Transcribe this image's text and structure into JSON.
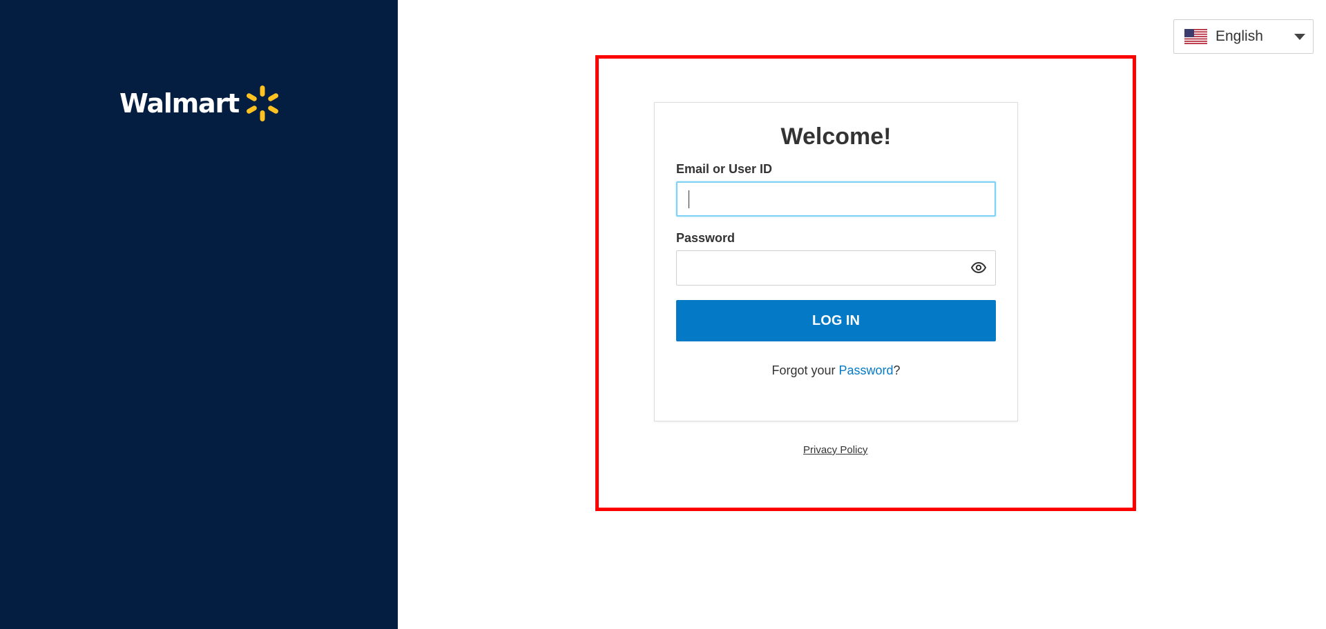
{
  "brand": {
    "logo_text": "Walmart",
    "spark_color": "#ffc220",
    "sidebar_color": "#041e42"
  },
  "language": {
    "selected": "English",
    "flag_icon": "us-flag-icon"
  },
  "login": {
    "title": "Welcome!",
    "email_label": "Email or User ID",
    "email_value": "",
    "password_label": "Password",
    "password_value": "",
    "show_password_icon": "eye-icon",
    "login_button": "LOG IN",
    "forgot_prefix": "Forgot your ",
    "forgot_link": "Password",
    "forgot_suffix": "?",
    "button_color": "#0479c6"
  },
  "footer": {
    "privacy_policy": "Privacy Policy"
  },
  "annotation": {
    "highlight_color": "#ff0000"
  }
}
